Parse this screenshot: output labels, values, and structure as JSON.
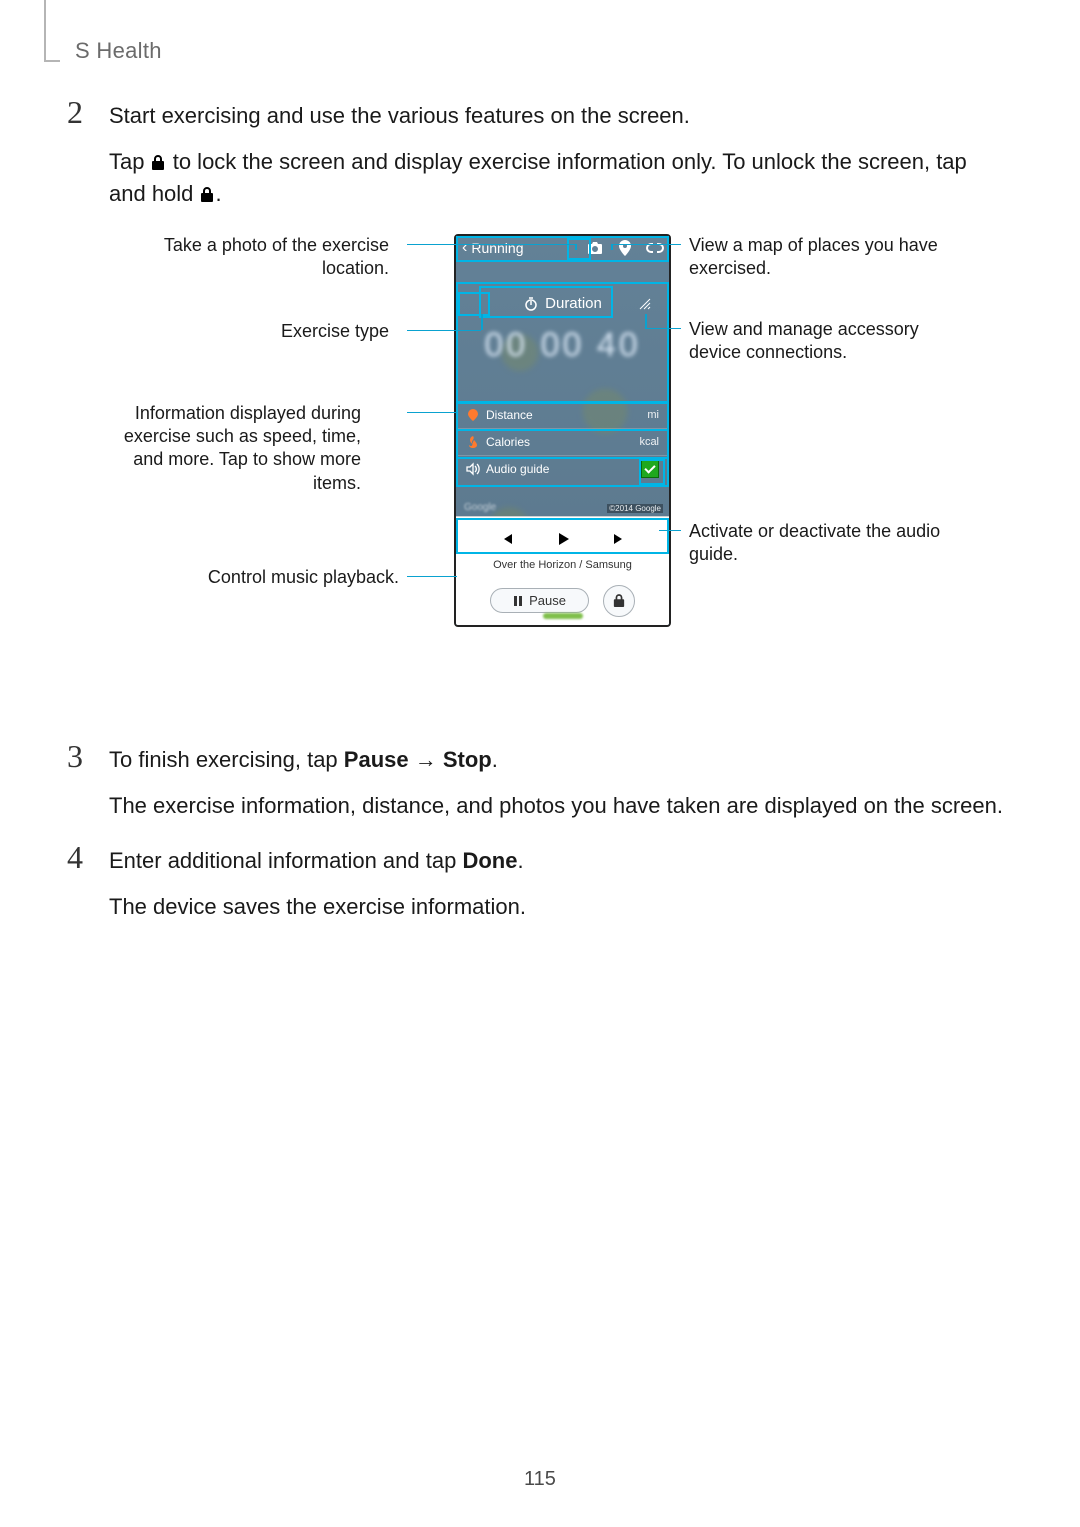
{
  "header": {
    "section_title": "S Health"
  },
  "steps": {
    "s2": {
      "num": "2",
      "p1": "Start exercising and use the various features on the screen.",
      "p2a": "Tap ",
      "p2b": " to lock the screen and display exercise information only. To unlock the screen, tap and hold ",
      "p2c": "."
    },
    "s3": {
      "num": "3",
      "p1a": "To finish exercising, tap ",
      "p1_pause": "Pause",
      "p1_arrow": " → ",
      "p1_stop": "Stop",
      "p1b": ".",
      "p2": "The exercise information, distance, and photos you have taken are displayed on the screen."
    },
    "s4": {
      "num": "4",
      "p1a": "Enter additional information and tap ",
      "p1_done": "Done",
      "p1b": ".",
      "p2": "The device saves the exercise information."
    }
  },
  "callouts": {
    "photo": "Take a photo of the exercise location.",
    "exercise_type": "Exercise type",
    "info_display": "Information displayed during exercise such as speed, time, and more. Tap to show more items.",
    "music": "Control music playback.",
    "map": "View a map of places you have exercised.",
    "accessory": "View and manage accessory device connections.",
    "audio": "Activate or deactivate the audio guide."
  },
  "phone_ui": {
    "back_chevron": "‹",
    "title": "Running",
    "duration_label": "Duration",
    "timer": "00 00 40",
    "stats": {
      "distance_label": "Distance",
      "distance_unit": "mi",
      "calories_label": "Calories",
      "calories_unit": "kcal",
      "audio_label": "Audio guide"
    },
    "map_brand": "Google",
    "map_copyright": "©2014 Google",
    "music": {
      "track": "Over the Horizon / Samsung",
      "pause_label": "Pause"
    }
  },
  "page_number": "115"
}
